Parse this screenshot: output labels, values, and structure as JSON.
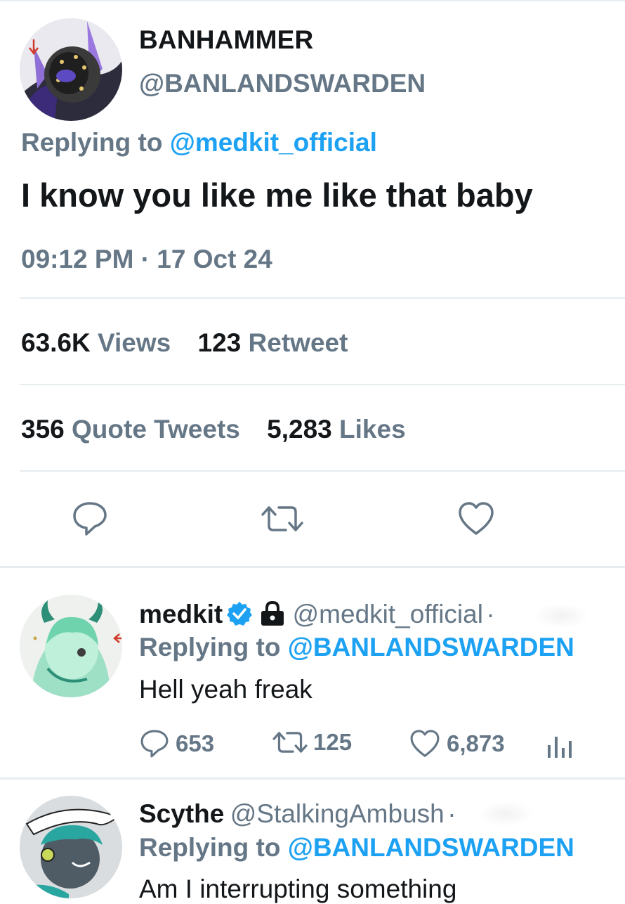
{
  "main_tweet": {
    "display_name": "BANHAMMER",
    "handle": "@BANLANDSWARDEN",
    "replying_prefix": "Replying to",
    "replying_to": "@medkit_official",
    "text": "I know you like me like that baby",
    "timestamp": "09:12 PM · 17 Oct 24",
    "stats": {
      "views_count": "63.6K",
      "views_label": "Views",
      "retweets_count": "123",
      "retweets_label": "Retweet",
      "quotes_count": "356",
      "quotes_label": "Quote Tweets",
      "likes_count": "5,283",
      "likes_label": "Likes"
    },
    "actions": [
      "reply-icon",
      "retweet-icon",
      "like-icon"
    ]
  },
  "replies": [
    {
      "display_name": "medkit",
      "verified": true,
      "protected": true,
      "handle": "@medkit_official",
      "separator": "·",
      "replying_prefix": "Replying to",
      "replying_to": "@BANLANDSWARDEN",
      "text": "Hell yeah freak",
      "reply_count": "653",
      "retweet_count": "125",
      "like_count": "6,873"
    },
    {
      "display_name": "Scythe",
      "handle": "@StalkingAmbush",
      "separator": "·",
      "replying_prefix": "Replying to",
      "replying_to": "@BANLANDSWARDEN",
      "text": "Am I interrupting something"
    }
  ],
  "colors": {
    "accent": "#1da1f2",
    "secondary_text": "#657786",
    "primary_text": "#14171a",
    "divider": "#e6ecf0"
  }
}
